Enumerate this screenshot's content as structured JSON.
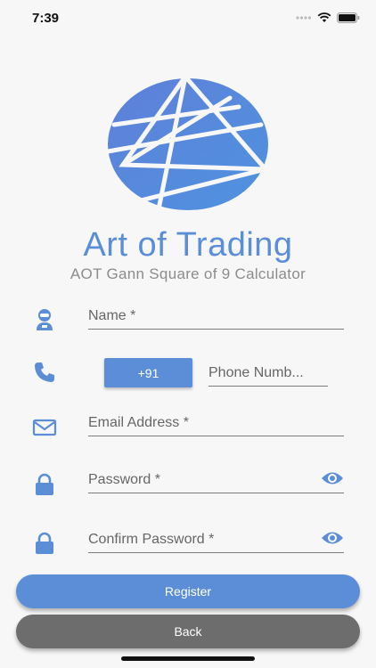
{
  "status": {
    "time": "7:39"
  },
  "app": {
    "title": "Art of Trading",
    "subtitle": "AOT Gann Square of 9 Calculator"
  },
  "form": {
    "name_placeholder": "Name *",
    "country_code": "+91",
    "phone_placeholder": "Phone Numb...",
    "email_placeholder": "Email Address *",
    "password_placeholder": "Password *",
    "confirm_password_placeholder": "Confirm Password *"
  },
  "buttons": {
    "register": "Register",
    "back": "Back"
  },
  "icons": [
    "user-icon",
    "phone-icon",
    "email-icon",
    "lock-icon",
    "eye-icon",
    "signal-icon",
    "wifi-icon",
    "battery-icon"
  ],
  "colors": {
    "accent": "#5b8ed6",
    "back_button": "#6d6d6d",
    "background": "#f7f7f8"
  }
}
